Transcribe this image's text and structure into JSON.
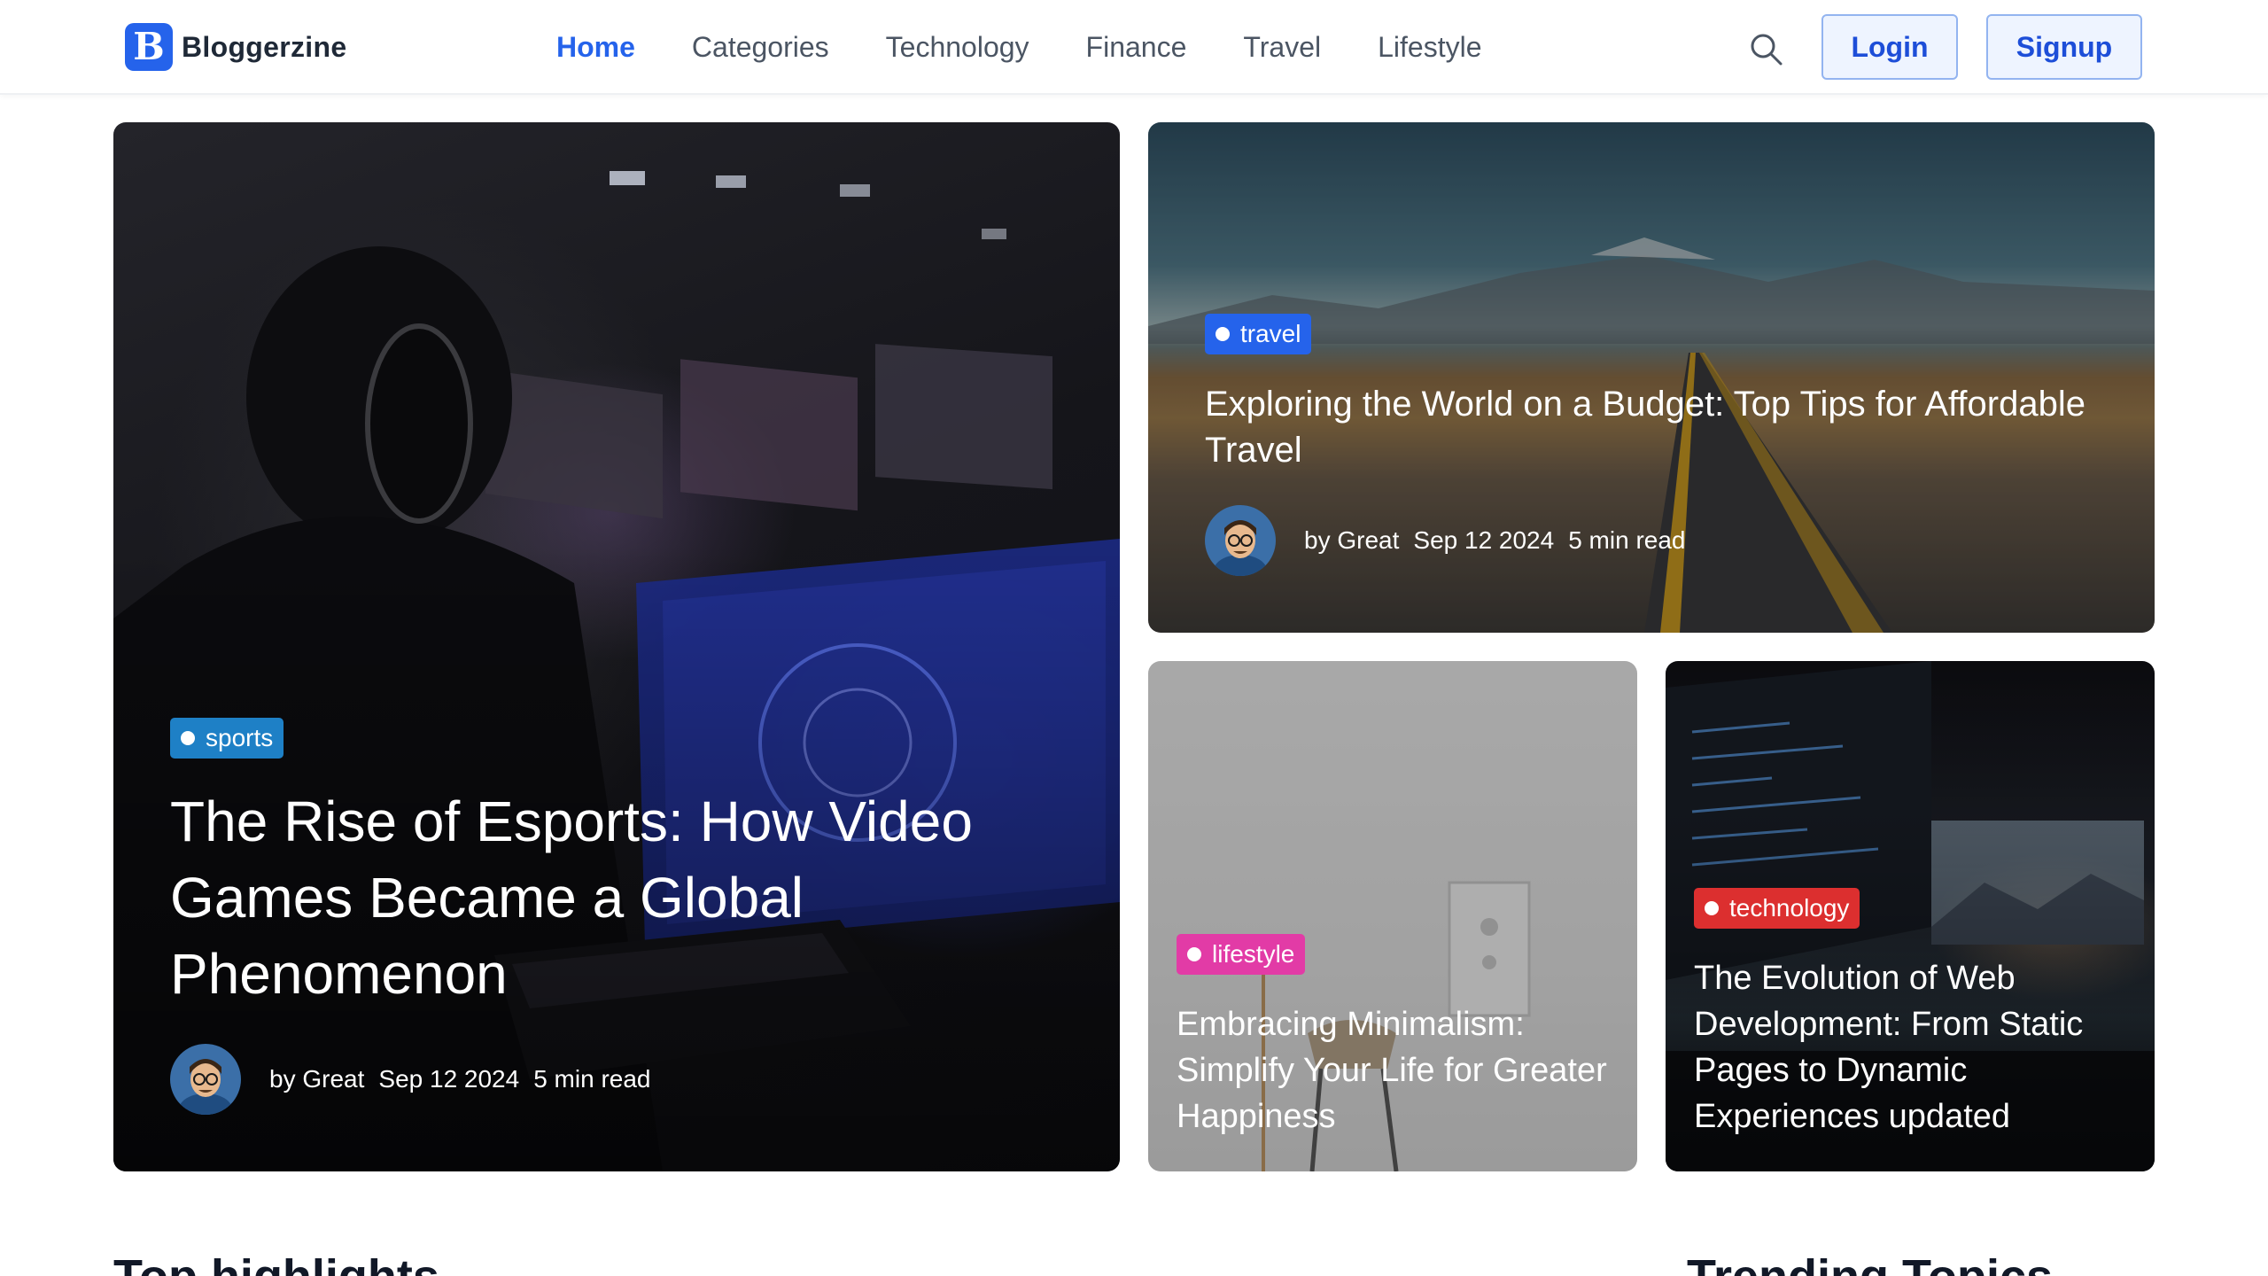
{
  "brand": {
    "logo_letter": "B",
    "name": "Bloggerzine",
    "accent": "#2563eb"
  },
  "nav": {
    "items": [
      {
        "label": "Home",
        "active": true
      },
      {
        "label": "Categories",
        "active": false
      },
      {
        "label": "Technology",
        "active": false
      },
      {
        "label": "Finance",
        "active": false
      },
      {
        "label": "Travel",
        "active": false
      },
      {
        "label": "Lifestyle",
        "active": false
      }
    ],
    "search_icon": "search-icon",
    "login": "Login",
    "signup": "Signup"
  },
  "featured": [
    {
      "category": "sports",
      "badge_color": "#1e80c6",
      "title": "The Rise of Esports: How Video Games Became a Global Phenomenon",
      "author": "by Great",
      "date": "Sep 12 2024",
      "read_time": "5 min read"
    },
    {
      "category": "travel",
      "badge_color": "#2563eb",
      "title": "Exploring the World on a Budget: Top Tips for Affordable Travel",
      "author": "by Great",
      "date": "Sep 12 2024",
      "read_time": "5 min read"
    },
    {
      "category": "lifestyle",
      "badge_color": "#e23ba6",
      "title": "Embracing Minimalism: Simplify Your Life for Greater Happiness"
    },
    {
      "category": "technology",
      "badge_color": "#dc2f2f",
      "title": "The Evolution of Web Development: From Static Pages to Dynamic Experiences updated"
    }
  ],
  "sections": {
    "left_heading": "Top highlights",
    "right_heading": "Trending Topics"
  }
}
